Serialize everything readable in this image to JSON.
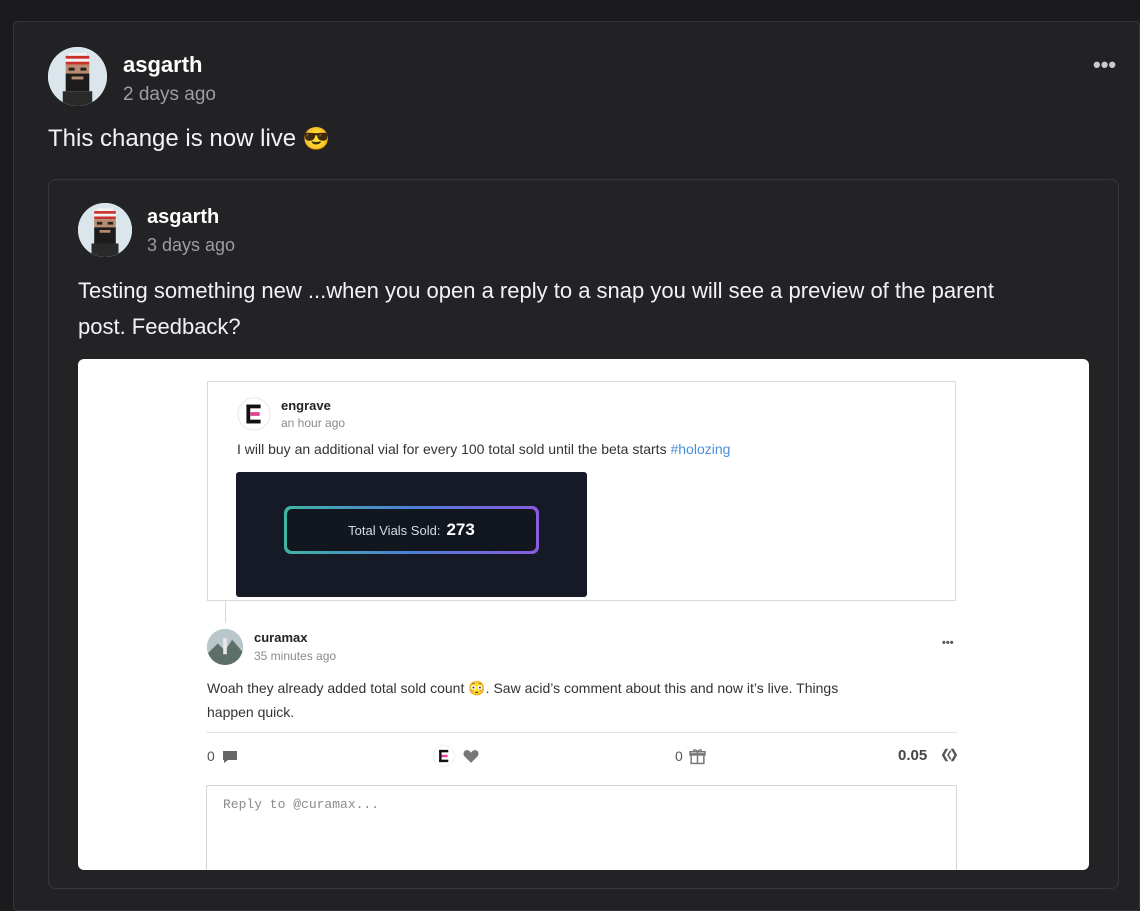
{
  "post": {
    "username": "asgarth",
    "time": "2 days ago",
    "body": "This change is now live",
    "body_emoji": "😎",
    "more": "•••"
  },
  "quoted": {
    "username": "asgarth",
    "time": "3 days ago",
    "body_line1": "Testing something new ...when you open a reply to a snap you will see a preview of the parent",
    "body_line2": "post. Feedback?"
  },
  "screenshot": {
    "parent": {
      "username": "engrave",
      "time": "an hour ago",
      "text": "I will buy an additional vial for every 100 total sold until the beta starts ",
      "hashtag": "#holozing",
      "vial_label": "Total Vials Sold:",
      "vial_value": "273"
    },
    "reply": {
      "username": "curamax",
      "time": "35 minutes ago",
      "line1": "Woah they already added total sold count 😳. Saw acid’s comment about this and now it’s live. Things",
      "line2": "happen quick.",
      "more": "•••"
    },
    "actions": {
      "comments": "0",
      "gifts": "0",
      "payout": "0.05"
    },
    "reply_placeholder": "Reply to @curamax...",
    "icons": {
      "comment": "comment-icon",
      "heart": "heart-icon",
      "gift": "gift-icon",
      "hive": "hive-icon",
      "engrave": "engrave-logo-icon"
    }
  }
}
